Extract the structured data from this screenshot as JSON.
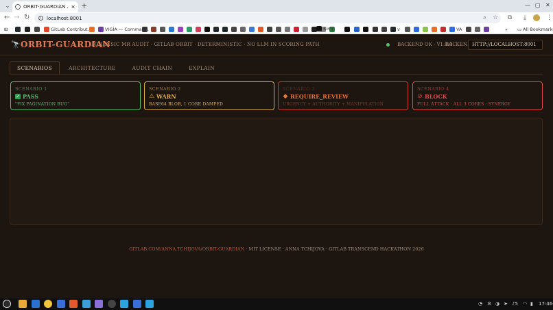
{
  "browser": {
    "tab_title": "ORBIT-GUARDIAN — Forensic",
    "url": "localhost:8001",
    "bookmarks": [
      {
        "label": "GitLab Contribut...",
        "color": "#e24329"
      },
      {
        "label": "VIGÍA — Comman...",
        "color": "#6b3fa0"
      },
      {
        "label": "Kimi",
        "color": "#111111"
      },
      {
        "label": "v",
        "color": "#24292f"
      },
      {
        "label": "VA",
        "color": "#2d6cdf"
      }
    ],
    "all_bookmarks_label": "All Bookmarks"
  },
  "header": {
    "logo_glyph": "🔭",
    "brand": "ORBIT-GUARDIAN",
    "tagline": "Forensic MR Audit · GitLab Orbit · Deterministic · No LLM in scoring path",
    "backend_status": "Backend OK · v1.0.0",
    "backend_label": "Backend",
    "backend_url": "http://localhost:8001"
  },
  "tabs": [
    {
      "label": "Scenarios",
      "active": true
    },
    {
      "label": "Architecture",
      "active": false
    },
    {
      "label": "Audit Chain",
      "active": false
    },
    {
      "label": "Explain",
      "active": false
    }
  ],
  "scenarios": [
    {
      "label": "Scenario 1",
      "verdict": "PASS",
      "icon": "check-icon",
      "glyph": "✓",
      "desc": "\"Fix pagination bug\"",
      "color": "#5bbf73",
      "ico_bg": "#2e9e4f"
    },
    {
      "label": "Scenario 2",
      "verdict": "WARN",
      "icon": "warning-icon",
      "glyph": "⚠",
      "desc": "Base64 blob, 1 core damped",
      "color": "#e0b04a",
      "ico_bg": "#d9a524"
    },
    {
      "label": "Scenario 3",
      "verdict": "REQUIRE_REVIEW",
      "icon": "diamond-icon",
      "glyph": "◆",
      "desc": "Urgency + authority + manipulation",
      "color": "#e0703a",
      "ico_bg": "#e07b34"
    },
    {
      "label": "Scenario 4",
      "verdict": "BLOCK",
      "icon": "no-entry-icon",
      "glyph": "⊘",
      "desc": "Full attack · all 3 cores · synergy",
      "color": "#e04848",
      "ico_bg": "#d63a3a"
    }
  ],
  "footer": {
    "repo": "gitlab.com/anna.tchijova/orbit-guardian",
    "sep1": " · ",
    "license": "MIT License",
    "sep2": " · ",
    "author": "Anna Tchijova",
    "sep3": " · ",
    "event": "GitLab Transcend Hackathon 2026"
  },
  "taskbar": {
    "time": "17:46",
    "volume": "5"
  }
}
